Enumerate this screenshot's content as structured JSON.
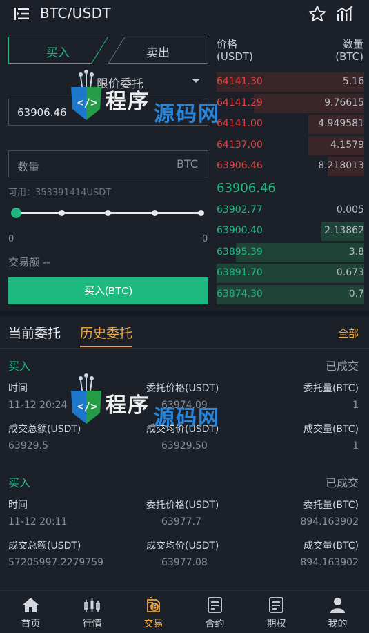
{
  "header": {
    "title": "BTC/USDT"
  },
  "trade_form": {
    "buy_tab": "买入",
    "sell_tab": "卖出",
    "order_type": "限价委托",
    "price_value": "63906.46",
    "qty_placeholder": "数量",
    "qty_unit": "BTC",
    "available": "可用：353391414USDT",
    "slider_percent": 0,
    "range_min": "0",
    "range_max": "0",
    "trade_amount": "交易额 --",
    "buy_button": "买入(BTC)"
  },
  "order_book": {
    "price_header": [
      "价格",
      "(USDT)"
    ],
    "qty_header": [
      "数量",
      "(BTC)"
    ],
    "asks": [
      {
        "price": "64141.30",
        "qty": "5.16",
        "depth": 1.0
      },
      {
        "price": "64141.29",
        "qty": "9.76615",
        "depth": 0.75
      },
      {
        "price": "64141.00",
        "qty": "4.949581",
        "depth": 0.38
      },
      {
        "price": "64137.00",
        "qty": "4.1579",
        "depth": 0.38
      },
      {
        "price": "63906.46",
        "qty": "8.218013",
        "depth": 0.25
      }
    ],
    "last_price": "63906.46",
    "bids": [
      {
        "price": "63902.77",
        "qty": "0.005",
        "depth": 0.0
      },
      {
        "price": "63900.40",
        "qty": "2.13862",
        "depth": 0.29
      },
      {
        "price": "63895.39",
        "qty": "3.8",
        "depth": 0.87
      },
      {
        "price": "63891.70",
        "qty": "0.673",
        "depth": 1.0
      },
      {
        "price": "63874.30",
        "qty": "0.7",
        "depth": 1.0
      }
    ]
  },
  "orders": {
    "tab_current": "当前委托",
    "tab_history": "历史委托",
    "all_link": "全部",
    "list": [
      {
        "side": "买入",
        "status": "已成交",
        "label_time": "时间",
        "label_price": "委托价格(USDT)",
        "label_qty": "委托量(BTC)",
        "time": "11-12 20:24",
        "price": "63974.09",
        "qty": "1",
        "label_total": "成交总额(USDT)",
        "label_avg": "成交均价(USDT)",
        "label_filled": "成交量(BTC)",
        "total": "63929.5",
        "avg": "63929.50",
        "filled": "1"
      },
      {
        "side": "买入",
        "status": "已成交",
        "label_time": "时间",
        "label_price": "委托价格(USDT)",
        "label_qty": "委托量(BTC)",
        "time": "11-12 20:11",
        "price": "63977.7",
        "qty": "894.163902",
        "label_total": "成交总额(USDT)",
        "label_avg": "成交均价(USDT)",
        "label_filled": "成交量(BTC)",
        "total": "57205997.2279759",
        "avg": "63977.08",
        "filled": "894.163902"
      }
    ]
  },
  "watermark": {
    "text_a": "程序",
    "text_b": "源码网"
  },
  "nav": {
    "items": [
      {
        "label": "首页",
        "icon": "home-icon"
      },
      {
        "label": "行情",
        "icon": "candlestick-icon"
      },
      {
        "label": "交易",
        "icon": "trade-icon"
      },
      {
        "label": "合约",
        "icon": "contract-icon"
      },
      {
        "label": "期权",
        "icon": "options-icon"
      },
      {
        "label": "我的",
        "icon": "user-icon"
      }
    ],
    "active_index": 2
  },
  "colors": {
    "accent_green": "#1eb980",
    "ask_red": "#e04444",
    "highlight_orange": "#f0a640",
    "background": "#1b2029"
  }
}
